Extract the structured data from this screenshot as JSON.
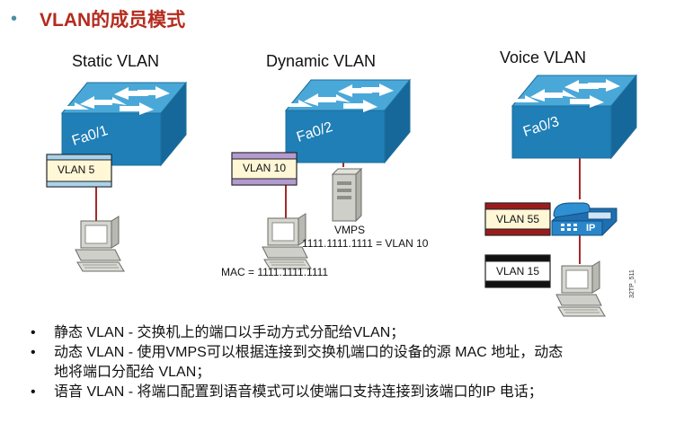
{
  "title": "VLAN的成员模式",
  "sections": {
    "static": {
      "heading": "Static VLAN",
      "port": "Fa0/1",
      "vlan": "VLAN 5"
    },
    "dynamic": {
      "heading": "Dynamic VLAN",
      "port": "Fa0/2",
      "vlan": "VLAN 10",
      "server_label": "VMPS",
      "mapping": "1111.1111.1111 = VLAN 10",
      "mac": "MAC = 1111.1111.1111"
    },
    "voice": {
      "heading": "Voice VLAN",
      "port": "Fa0/3",
      "voice_vlan": "VLAN 55",
      "data_vlan": "VLAN 15",
      "phone_badge": "IP",
      "figure_code": "32TP_511"
    }
  },
  "bullets": [
    {
      "line1": "静态 VLAN  -  交换机上的端口以手动方式分配给VLAN；"
    },
    {
      "line1": "动态 VLAN  - 使用VMPS可以根据连接到交换机端口的设备的源 MAC 地址，动态",
      "line2": "地将端口分配给 VLAN；"
    },
    {
      "line1": "语音 VLAN  -  将端口配置到语音模式可以使端口支持连接到该端口的IP 电话；"
    }
  ],
  "colors": {
    "title": "#b42b1e",
    "switch_top": "#4aa8d8",
    "switch_front": "#1f7fb6",
    "link": "#a52a2a",
    "vlan5": "#a9d3ec",
    "vlan10": "#b39ad0",
    "vlan55": "#9b1c1c",
    "vlan15": "#111111",
    "tag_body": "#fff7d6"
  },
  "icons": [
    "switch-icon",
    "computer-icon",
    "server-icon",
    "ip-phone-icon"
  ]
}
